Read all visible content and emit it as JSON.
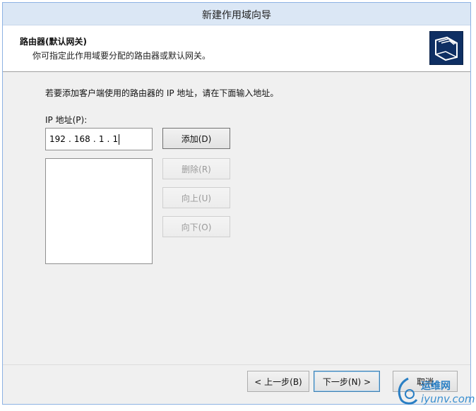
{
  "window": {
    "title": "新建作用域向导"
  },
  "header": {
    "title": "路由器(默认网关)",
    "subtitle": "你可指定此作用域要分配的路由器或默认网关。",
    "icon": "folder-stack-icon"
  },
  "main": {
    "description": "若要添加客户端使用的路由器的 IP 地址，请在下面输入地址。",
    "ip_label": "IP 地址(P):",
    "ip_octets": [
      "192",
      "168",
      "1",
      "1"
    ],
    "ip_separator": ".",
    "router_list": [],
    "buttons": {
      "add": "添加(D)",
      "remove": "删除(R)",
      "up": "向上(U)",
      "down": "向下(O)"
    }
  },
  "footer": {
    "back": "< 上一步(B)",
    "next": "下一步(N) >",
    "cancel": "取消"
  },
  "watermark": {
    "line1": "运维网",
    "line2": "iyunv.com"
  },
  "colors": {
    "titlebar": "#dbe7f5",
    "header_icon_bg": "#0f2f63",
    "watermark": "#2a7fc4"
  }
}
